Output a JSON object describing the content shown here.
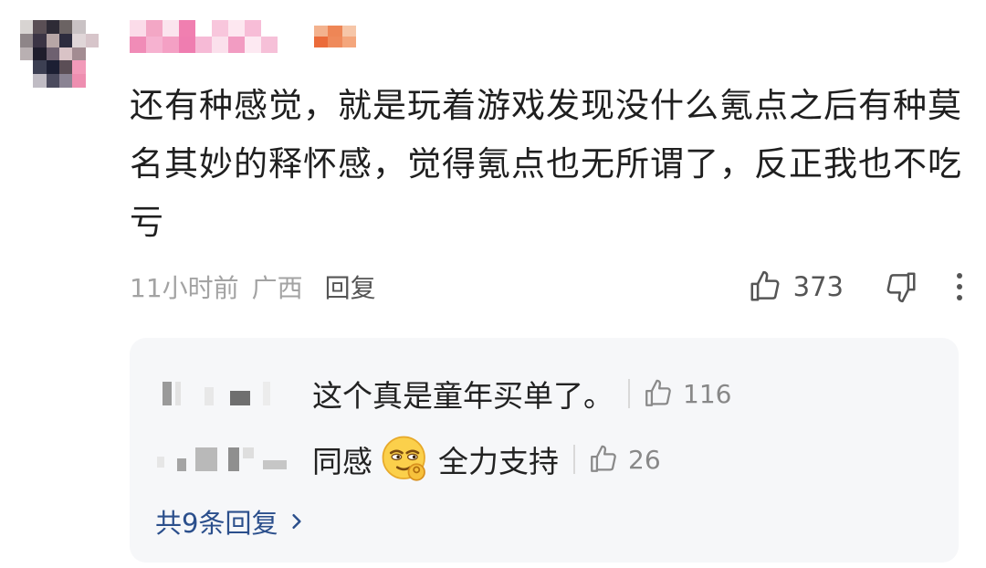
{
  "comment": {
    "text": "还有种感觉，就是玩着游戏发现没什么氪点之后有种莫名其妙的释怀感，觉得氪点也无所谓了，反正我也不吃亏",
    "time": "11小时前",
    "location": "广西",
    "reply_label": "回复",
    "like_count": "373",
    "icons": {
      "like": "thumbs-up-icon",
      "dislike": "thumbs-down-icon",
      "more": "more-vertical-icon"
    }
  },
  "replies": [
    {
      "text": "这个真是童年买单了。",
      "like_count": "116"
    },
    {
      "text_before": "同感",
      "emoji": "smirk-ok-emoji",
      "text_after": "全力支持",
      "like_count": "26"
    }
  ],
  "more_replies": {
    "label": "共9条回复",
    "icon": "chevron-right-icon"
  },
  "colors": {
    "link": "#2b4f8c",
    "meta": "#a3a3a3",
    "reply_bg": "#f6f7f9"
  }
}
